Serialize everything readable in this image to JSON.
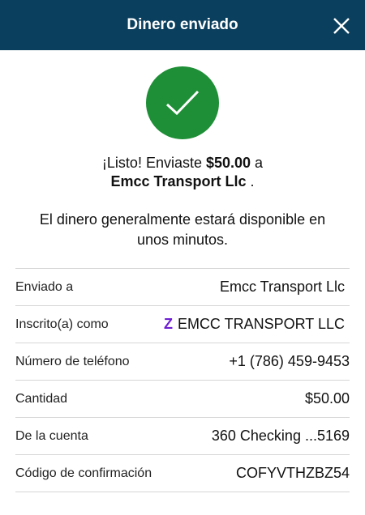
{
  "header": {
    "title": "Dinero enviado"
  },
  "success": {
    "prefix": "¡Listo! Enviaste ",
    "amount": "$50.00",
    "connector": " a",
    "recipient": "Emcc Transport Llc",
    "suffix": " ."
  },
  "note": "El dinero generalmente estará disponible en unos minutos.",
  "details": [
    {
      "label": "Enviado a",
      "value": "Emcc Transport Llc"
    },
    {
      "label": "Inscrito(a) como",
      "value": "EMCC TRANSPORT LLC",
      "icon": "zelle-icon"
    },
    {
      "label": "Número de teléfono",
      "value": "+1 (786) 459-9453"
    },
    {
      "label": "Cantidad",
      "value": "$50.00"
    },
    {
      "label": "De la cuenta",
      "value": "360 Checking ...5169"
    },
    {
      "label": "Código de confirmación",
      "value": "COFYVTHZBZ54"
    }
  ],
  "colors": {
    "header": "#0b3f5e",
    "success": "#1e8f36",
    "zelle": "#6d1ed4"
  }
}
